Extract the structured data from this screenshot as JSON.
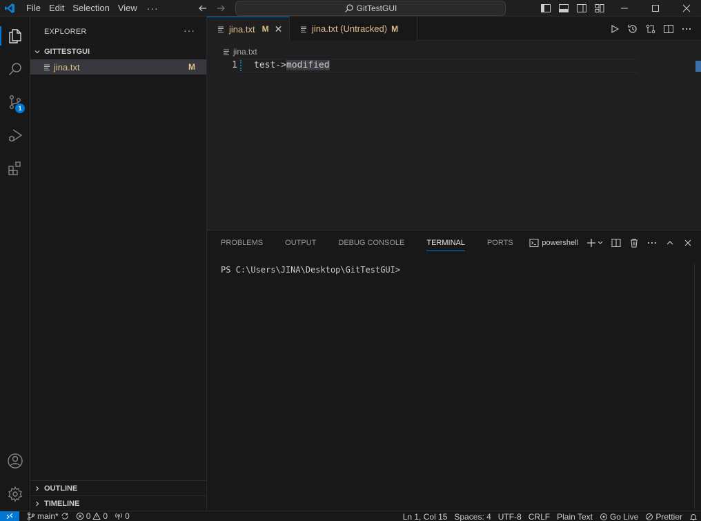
{
  "menu": {
    "items": [
      "File",
      "Edit",
      "Selection",
      "View"
    ],
    "more": "···"
  },
  "search": {
    "label": "GitTestGUI"
  },
  "explorer": {
    "title": "EXPLORER",
    "more": "···",
    "folder": "GITTESTGUI",
    "files": [
      {
        "name": "jina.txt",
        "status": "M"
      }
    ],
    "outline": "OUTLINE",
    "timeline": "TIMELINE"
  },
  "activity": {
    "source_control_badge": "1"
  },
  "tabs": [
    {
      "label": "jina.txt",
      "status": "M",
      "close": "✕"
    },
    {
      "label": "jina.txt (Untracked)",
      "status": "M"
    }
  ],
  "editor": {
    "breadcrumb": "jina.txt",
    "line_number": "1",
    "code_plain": "test->",
    "code_selected": "modified"
  },
  "panel": {
    "tabs": [
      "PROBLEMS",
      "OUTPUT",
      "DEBUG CONSOLE",
      "TERMINAL",
      "PORTS"
    ],
    "active_tab": "TERMINAL",
    "shell": "powershell",
    "prompt": "PS C:\\Users\\JINA\\Desktop\\GitTestGUI>"
  },
  "status": {
    "branch": "main*",
    "errors": "0",
    "warnings": "0",
    "ports": "0",
    "cursor": "Ln 1, Col 15",
    "spaces": "Spaces: 4",
    "encoding": "UTF-8",
    "eol": "CRLF",
    "language": "Plain Text",
    "golive": "Go Live",
    "prettier": "Prettier"
  },
  "colors": {
    "accent": "#0078d4",
    "modified": "#e2c08d",
    "background": "#1f1f1f"
  }
}
